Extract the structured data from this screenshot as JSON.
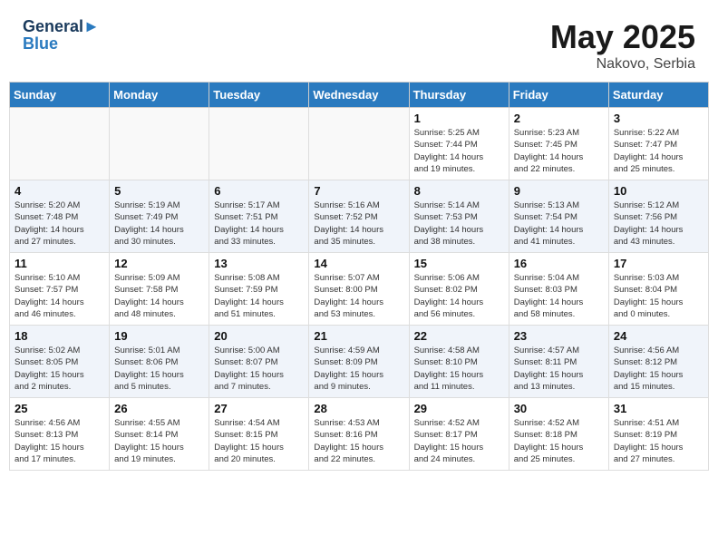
{
  "header": {
    "logo_line1": "General",
    "logo_line2": "Blue",
    "month_year": "May 2025",
    "location": "Nakovo, Serbia"
  },
  "weekdays": [
    "Sunday",
    "Monday",
    "Tuesday",
    "Wednesday",
    "Thursday",
    "Friday",
    "Saturday"
  ],
  "weeks": [
    [
      {
        "day": "",
        "info": ""
      },
      {
        "day": "",
        "info": ""
      },
      {
        "day": "",
        "info": ""
      },
      {
        "day": "",
        "info": ""
      },
      {
        "day": "1",
        "info": "Sunrise: 5:25 AM\nSunset: 7:44 PM\nDaylight: 14 hours\nand 19 minutes."
      },
      {
        "day": "2",
        "info": "Sunrise: 5:23 AM\nSunset: 7:45 PM\nDaylight: 14 hours\nand 22 minutes."
      },
      {
        "day": "3",
        "info": "Sunrise: 5:22 AM\nSunset: 7:47 PM\nDaylight: 14 hours\nand 25 minutes."
      }
    ],
    [
      {
        "day": "4",
        "info": "Sunrise: 5:20 AM\nSunset: 7:48 PM\nDaylight: 14 hours\nand 27 minutes."
      },
      {
        "day": "5",
        "info": "Sunrise: 5:19 AM\nSunset: 7:49 PM\nDaylight: 14 hours\nand 30 minutes."
      },
      {
        "day": "6",
        "info": "Sunrise: 5:17 AM\nSunset: 7:51 PM\nDaylight: 14 hours\nand 33 minutes."
      },
      {
        "day": "7",
        "info": "Sunrise: 5:16 AM\nSunset: 7:52 PM\nDaylight: 14 hours\nand 35 minutes."
      },
      {
        "day": "8",
        "info": "Sunrise: 5:14 AM\nSunset: 7:53 PM\nDaylight: 14 hours\nand 38 minutes."
      },
      {
        "day": "9",
        "info": "Sunrise: 5:13 AM\nSunset: 7:54 PM\nDaylight: 14 hours\nand 41 minutes."
      },
      {
        "day": "10",
        "info": "Sunrise: 5:12 AM\nSunset: 7:56 PM\nDaylight: 14 hours\nand 43 minutes."
      }
    ],
    [
      {
        "day": "11",
        "info": "Sunrise: 5:10 AM\nSunset: 7:57 PM\nDaylight: 14 hours\nand 46 minutes."
      },
      {
        "day": "12",
        "info": "Sunrise: 5:09 AM\nSunset: 7:58 PM\nDaylight: 14 hours\nand 48 minutes."
      },
      {
        "day": "13",
        "info": "Sunrise: 5:08 AM\nSunset: 7:59 PM\nDaylight: 14 hours\nand 51 minutes."
      },
      {
        "day": "14",
        "info": "Sunrise: 5:07 AM\nSunset: 8:00 PM\nDaylight: 14 hours\nand 53 minutes."
      },
      {
        "day": "15",
        "info": "Sunrise: 5:06 AM\nSunset: 8:02 PM\nDaylight: 14 hours\nand 56 minutes."
      },
      {
        "day": "16",
        "info": "Sunrise: 5:04 AM\nSunset: 8:03 PM\nDaylight: 14 hours\nand 58 minutes."
      },
      {
        "day": "17",
        "info": "Sunrise: 5:03 AM\nSunset: 8:04 PM\nDaylight: 15 hours\nand 0 minutes."
      }
    ],
    [
      {
        "day": "18",
        "info": "Sunrise: 5:02 AM\nSunset: 8:05 PM\nDaylight: 15 hours\nand 2 minutes."
      },
      {
        "day": "19",
        "info": "Sunrise: 5:01 AM\nSunset: 8:06 PM\nDaylight: 15 hours\nand 5 minutes."
      },
      {
        "day": "20",
        "info": "Sunrise: 5:00 AM\nSunset: 8:07 PM\nDaylight: 15 hours\nand 7 minutes."
      },
      {
        "day": "21",
        "info": "Sunrise: 4:59 AM\nSunset: 8:09 PM\nDaylight: 15 hours\nand 9 minutes."
      },
      {
        "day": "22",
        "info": "Sunrise: 4:58 AM\nSunset: 8:10 PM\nDaylight: 15 hours\nand 11 minutes."
      },
      {
        "day": "23",
        "info": "Sunrise: 4:57 AM\nSunset: 8:11 PM\nDaylight: 15 hours\nand 13 minutes."
      },
      {
        "day": "24",
        "info": "Sunrise: 4:56 AM\nSunset: 8:12 PM\nDaylight: 15 hours\nand 15 minutes."
      }
    ],
    [
      {
        "day": "25",
        "info": "Sunrise: 4:56 AM\nSunset: 8:13 PM\nDaylight: 15 hours\nand 17 minutes."
      },
      {
        "day": "26",
        "info": "Sunrise: 4:55 AM\nSunset: 8:14 PM\nDaylight: 15 hours\nand 19 minutes."
      },
      {
        "day": "27",
        "info": "Sunrise: 4:54 AM\nSunset: 8:15 PM\nDaylight: 15 hours\nand 20 minutes."
      },
      {
        "day": "28",
        "info": "Sunrise: 4:53 AM\nSunset: 8:16 PM\nDaylight: 15 hours\nand 22 minutes."
      },
      {
        "day": "29",
        "info": "Sunrise: 4:52 AM\nSunset: 8:17 PM\nDaylight: 15 hours\nand 24 minutes."
      },
      {
        "day": "30",
        "info": "Sunrise: 4:52 AM\nSunset: 8:18 PM\nDaylight: 15 hours\nand 25 minutes."
      },
      {
        "day": "31",
        "info": "Sunrise: 4:51 AM\nSunset: 8:19 PM\nDaylight: 15 hours\nand 27 minutes."
      }
    ]
  ]
}
